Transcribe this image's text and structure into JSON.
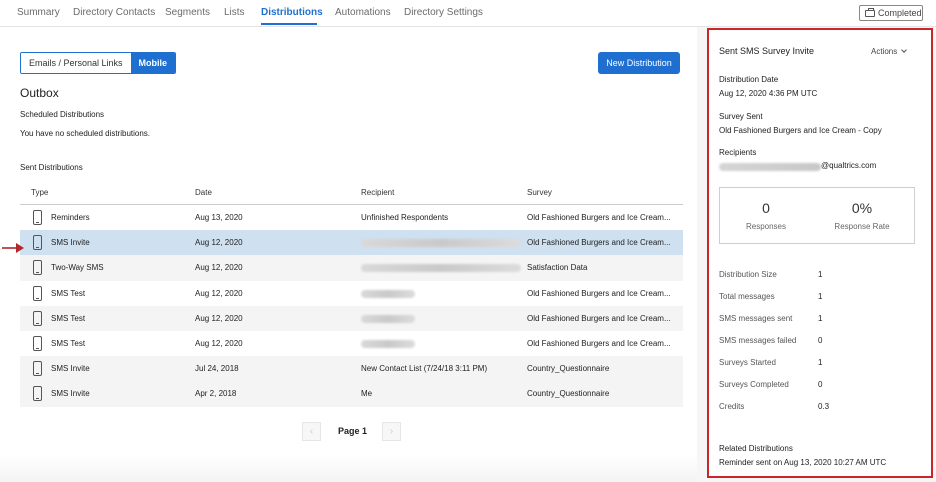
{
  "nav": {
    "tabs": [
      "Summary",
      "Directory Contacts",
      "Segments",
      "Lists",
      "Distributions",
      "Automations",
      "Directory Settings"
    ],
    "active_tab": "Distributions",
    "completed_label": "Completed"
  },
  "main": {
    "toggle": {
      "option_1": "Emails / Personal Links",
      "option_2": "Mobile",
      "selected": "Mobile"
    },
    "new_distribution_label": "New Distribution",
    "outbox_title": "Outbox",
    "scheduled_label": "Scheduled Distributions",
    "scheduled_empty": "You have no scheduled distributions.",
    "sent_label": "Sent Distributions",
    "table": {
      "headers": {
        "type": "Type",
        "date": "Date",
        "recipient": "Recipient",
        "survey": "Survey"
      },
      "rows": [
        {
          "type": "Reminders",
          "date": "Aug 13, 2020",
          "recipient": "Unfinished Respondents",
          "survey": "Old Fashioned Burgers and Ice Cream..."
        },
        {
          "type": "SMS Invite",
          "date": "Aug 12, 2020",
          "recipient": "",
          "survey": "Old Fashioned Burgers and Ice Cream...",
          "selected": true
        },
        {
          "type": "Two-Way SMS",
          "date": "Aug 12, 2020",
          "recipient": "",
          "survey": "Satisfaction Data"
        },
        {
          "type": "SMS Test",
          "date": "Aug 12, 2020",
          "recipient": "",
          "survey": "Old Fashioned Burgers and Ice Cream..."
        },
        {
          "type": "SMS Test",
          "date": "Aug 12, 2020",
          "recipient": "",
          "survey": "Old Fashioned Burgers and Ice Cream..."
        },
        {
          "type": "SMS Test",
          "date": "Aug 12, 2020",
          "recipient": "",
          "survey": "Old Fashioned Burgers and Ice Cream..."
        },
        {
          "type": "SMS Invite",
          "date": "Jul 24, 2018",
          "recipient": "New Contact List (7/24/18 3:11 PM)",
          "survey": "Country_Questionnaire"
        },
        {
          "type": "SMS Invite",
          "date": "Apr 2, 2018",
          "recipient": "Me",
          "survey": "Country_Questionnaire"
        }
      ]
    },
    "pagination": {
      "label": "Page 1",
      "prev": "‹",
      "next": "›"
    }
  },
  "panel": {
    "title": "Sent SMS Survey Invite",
    "actions_label": "Actions",
    "distribution_date_label": "Distribution Date",
    "distribution_date": "Aug 12, 2020 4:36 PM UTC",
    "survey_sent_label": "Survey Sent",
    "survey_sent": "Old Fashioned Burgers and Ice Cream - Copy",
    "recipients_label": "Recipients",
    "recipient_domain": "@qualtrics.com",
    "responses_value": "0",
    "responses_label": "Responses",
    "response_rate_value": "0%",
    "response_rate_label": "Response Rate",
    "metrics": [
      {
        "label": "Distribution Size",
        "value": "1"
      },
      {
        "label": "Total messages",
        "value": "1"
      },
      {
        "label": "SMS messages sent",
        "value": "1"
      },
      {
        "label": "SMS messages failed",
        "value": "0"
      },
      {
        "label": "Surveys Started",
        "value": "1"
      },
      {
        "label": "Surveys Completed",
        "value": "0"
      },
      {
        "label": "Credits",
        "value": "0.3"
      }
    ],
    "related_label": "Related Distributions",
    "related_value": "Reminder sent on Aug 13, 2020 10:27 AM UTC"
  },
  "colors": {
    "accent": "#1f6fd1",
    "highlight_border": "#c8262b",
    "selected_row": "#cfe0f0"
  }
}
